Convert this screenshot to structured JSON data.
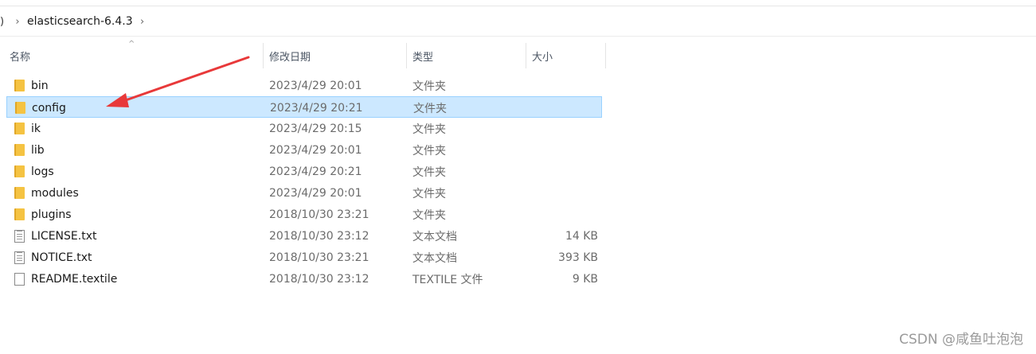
{
  "breadcrumb": {
    "edge_glyph": ")",
    "chevron": "›",
    "current": "elasticsearch-6.4.3"
  },
  "header": {
    "sort_arrow": "^",
    "columns": [
      "名称",
      "修改日期",
      "类型",
      "大小"
    ]
  },
  "files": [
    {
      "name": "bin",
      "date": "2023/4/29 20:01",
      "type": "文件夹",
      "size": "",
      "icon": "folder-icon",
      "selected": false
    },
    {
      "name": "config",
      "date": "2023/4/29 20:21",
      "type": "文件夹",
      "size": "",
      "icon": "folder-icon",
      "selected": true
    },
    {
      "name": "ik",
      "date": "2023/4/29 20:15",
      "type": "文件夹",
      "size": "",
      "icon": "folder-icon",
      "selected": false
    },
    {
      "name": "lib",
      "date": "2023/4/29 20:01",
      "type": "文件夹",
      "size": "",
      "icon": "folder-icon",
      "selected": false
    },
    {
      "name": "logs",
      "date": "2023/4/29 20:21",
      "type": "文件夹",
      "size": "",
      "icon": "folder-icon",
      "selected": false
    },
    {
      "name": "modules",
      "date": "2023/4/29 20:01",
      "type": "文件夹",
      "size": "",
      "icon": "folder-icon",
      "selected": false
    },
    {
      "name": "plugins",
      "date": "2018/10/30 23:21",
      "type": "文件夹",
      "size": "",
      "icon": "folder-icon",
      "selected": false
    },
    {
      "name": "LICENSE.txt",
      "date": "2018/10/30 23:12",
      "type": "文本文档",
      "size": "14 KB",
      "icon": "text-file-icon",
      "selected": false
    },
    {
      "name": "NOTICE.txt",
      "date": "2018/10/30 23:21",
      "type": "文本文档",
      "size": "393 KB",
      "icon": "text-file-icon",
      "selected": false
    },
    {
      "name": "README.textile",
      "date": "2018/10/30 23:12",
      "type": "TEXTILE 文件",
      "size": "9 KB",
      "icon": "file-icon",
      "selected": false
    }
  ],
  "annotation": {
    "arrow_color": "#e8393a"
  },
  "colors": {
    "selection_bg": "#cce8ff",
    "selection_border": "#99d1ff",
    "folder": "#f5c342"
  },
  "watermark": "CSDN @咸鱼吐泡泡"
}
